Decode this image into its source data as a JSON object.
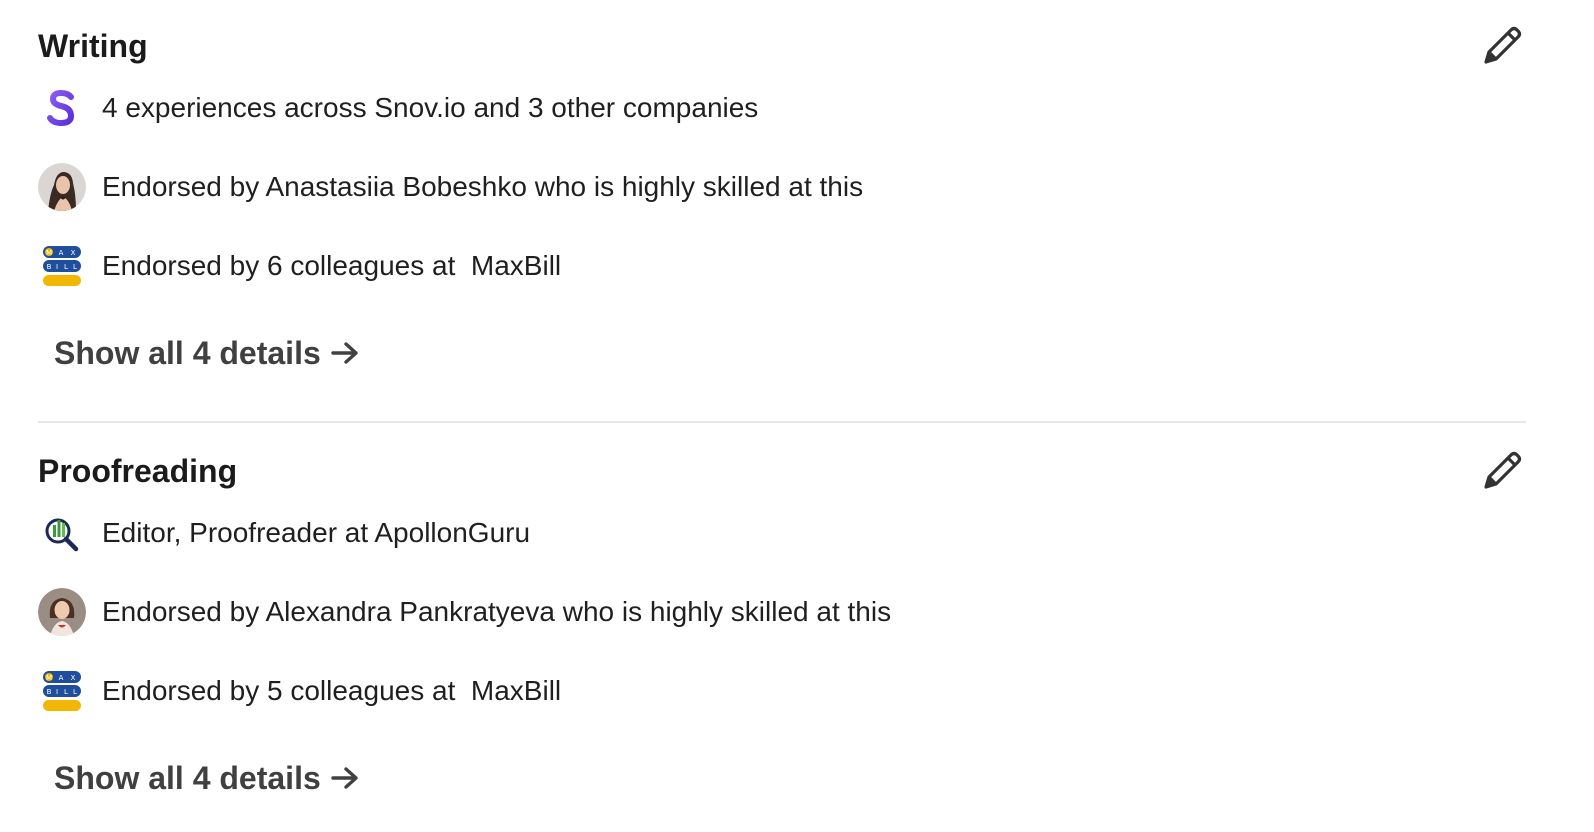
{
  "skills": [
    {
      "title": "Writing",
      "rows": [
        {
          "icon": "snovio-logo-icon",
          "text": "4 experiences across Snov.io and 3 other companies"
        },
        {
          "icon": "avatar-anastasiia",
          "text": "Endorsed by Anastasiia Bobeshko who is highly skilled at this"
        },
        {
          "icon": "maxbill-logo-icon",
          "text": "Endorsed by 6 colleagues at  MaxBill"
        }
      ],
      "show_all": "Show all 4 details"
    },
    {
      "title": "Proofreading",
      "rows": [
        {
          "icon": "apollonguru-logo-icon",
          "text": "Editor, Proofreader at ApollonGuru"
        },
        {
          "icon": "avatar-alexandra",
          "text": "Endorsed by Alexandra Pankratyeva who is highly skilled at this"
        },
        {
          "icon": "maxbill-logo-icon",
          "text": "Endorsed by 5 colleagues at  MaxBill"
        }
      ],
      "show_all": "Show all 4 details"
    }
  ],
  "icons": {
    "edit": "pencil-icon",
    "show_all_arrow": "arrow-right-icon"
  },
  "colors": {
    "snovio_purple": "#6a3fe0",
    "maxbill_blue": "#1f4e9c",
    "maxbill_yellow": "#f2b705",
    "apollon_green": "#3a9a3e",
    "apollon_navy": "#1b2a55",
    "divider": "#e8e8e8"
  }
}
